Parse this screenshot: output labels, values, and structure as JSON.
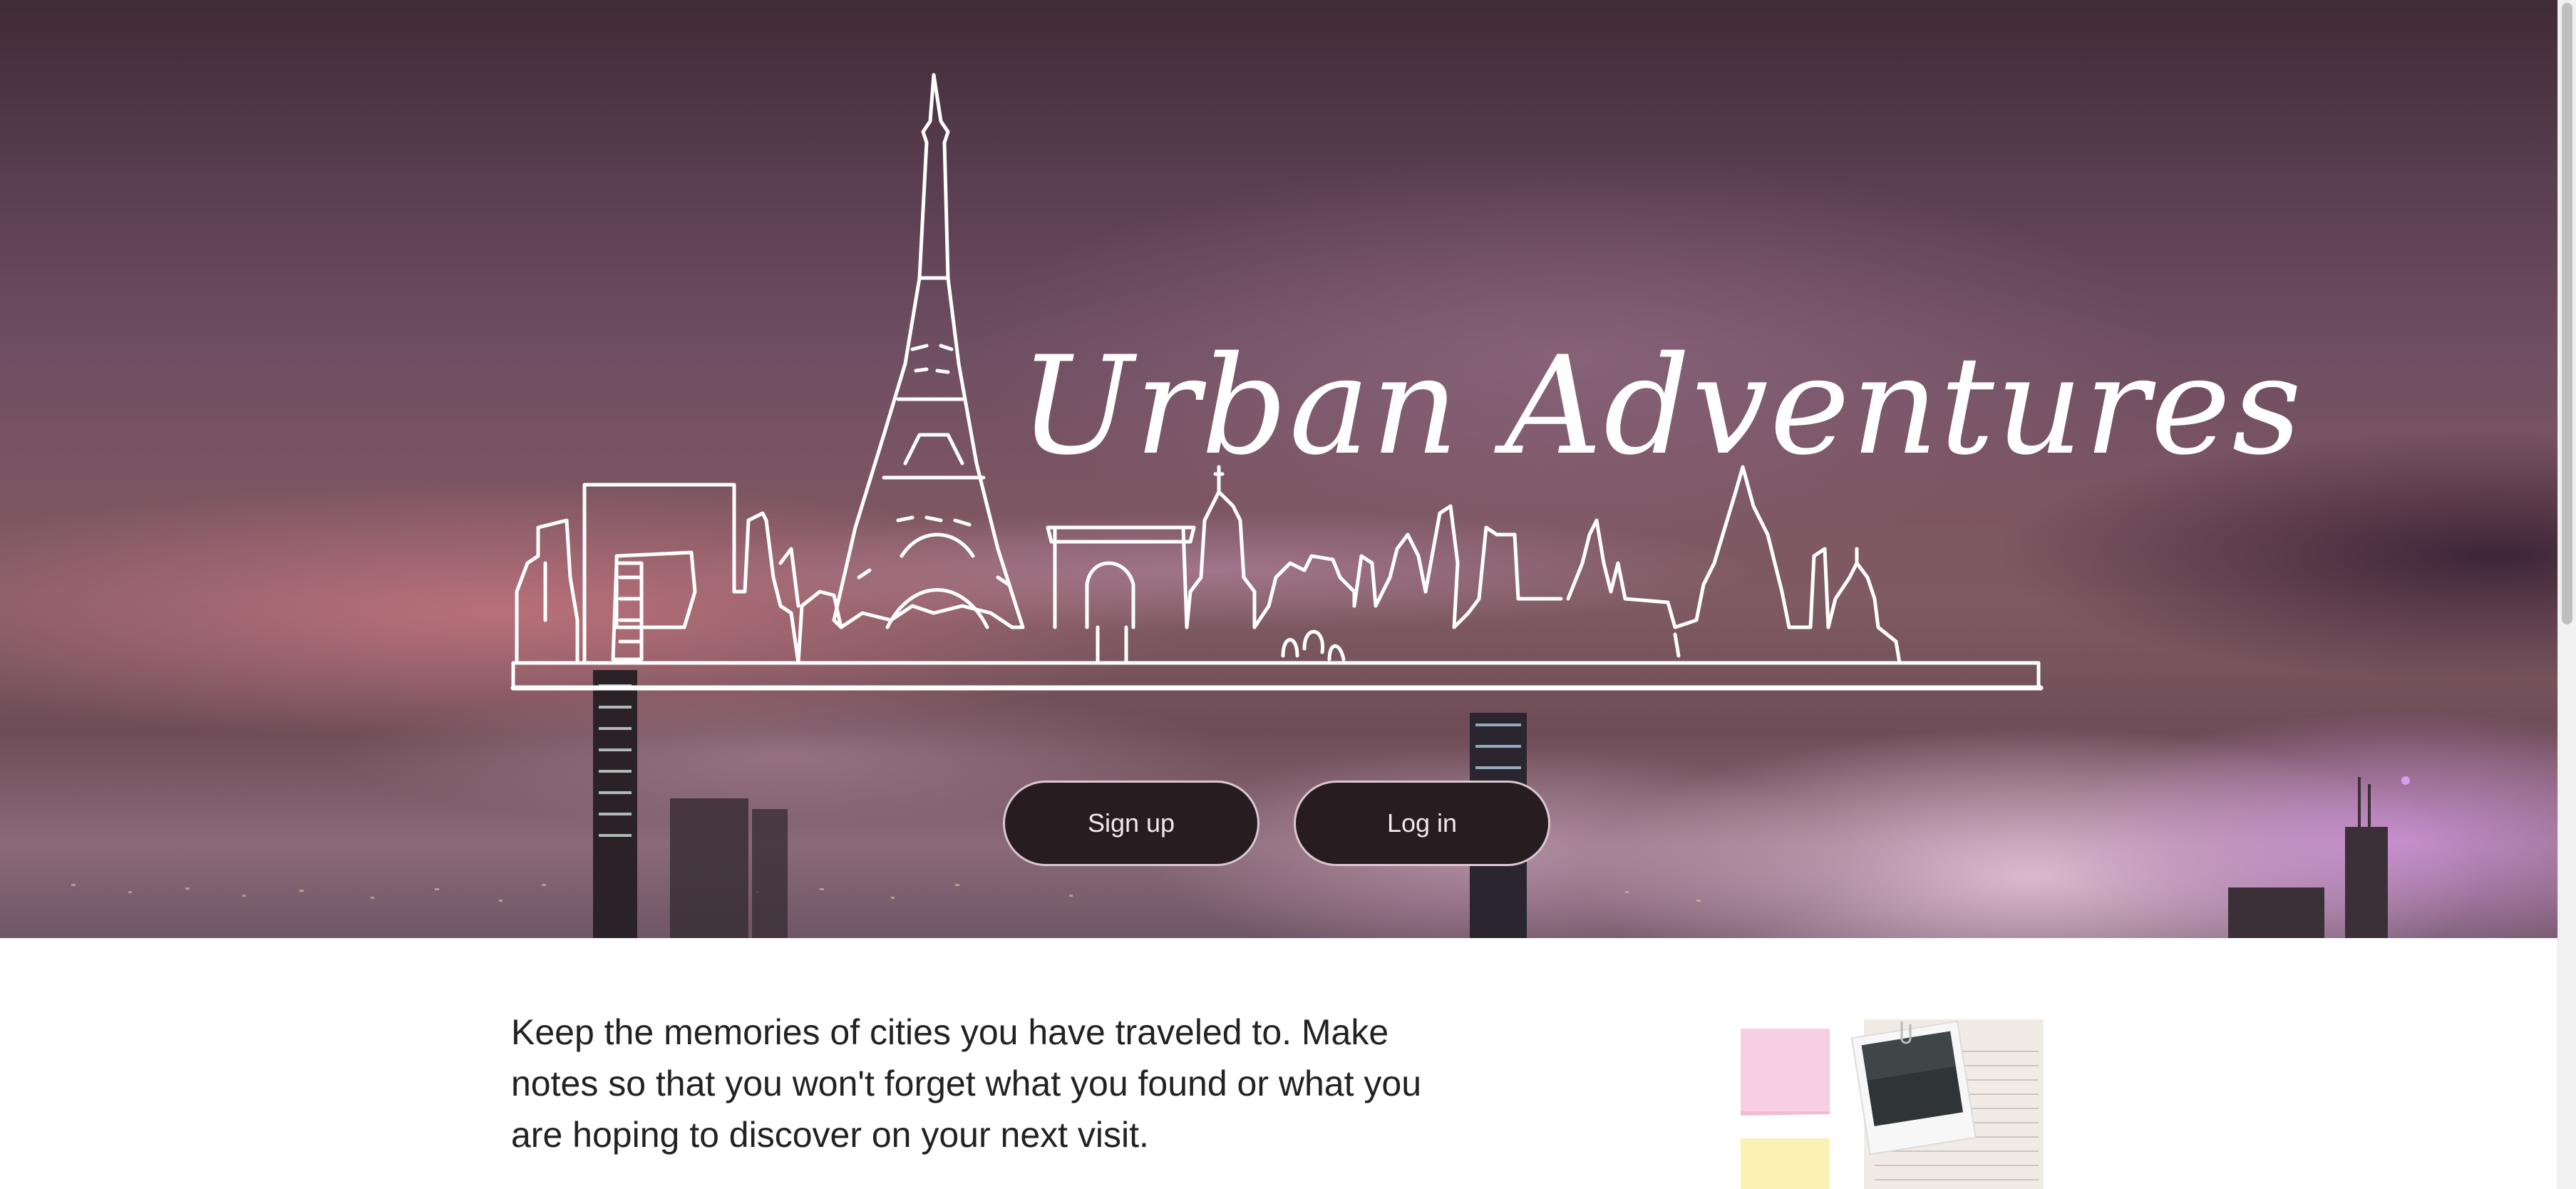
{
  "hero": {
    "title": "Urban Adventures",
    "signup_label": "Sign up",
    "login_label": "Log in"
  },
  "intro": {
    "text": "Keep the memories of cities you have traveled to. Make notes so that you won't forget what you found or what you are hoping to discover on your next visit."
  },
  "illustration": {
    "icon": "notes-and-photo-icon"
  },
  "colors": {
    "button_bg": "#271d21",
    "button_text": "#f1e9ed",
    "logo_stroke": "#ffffff"
  }
}
